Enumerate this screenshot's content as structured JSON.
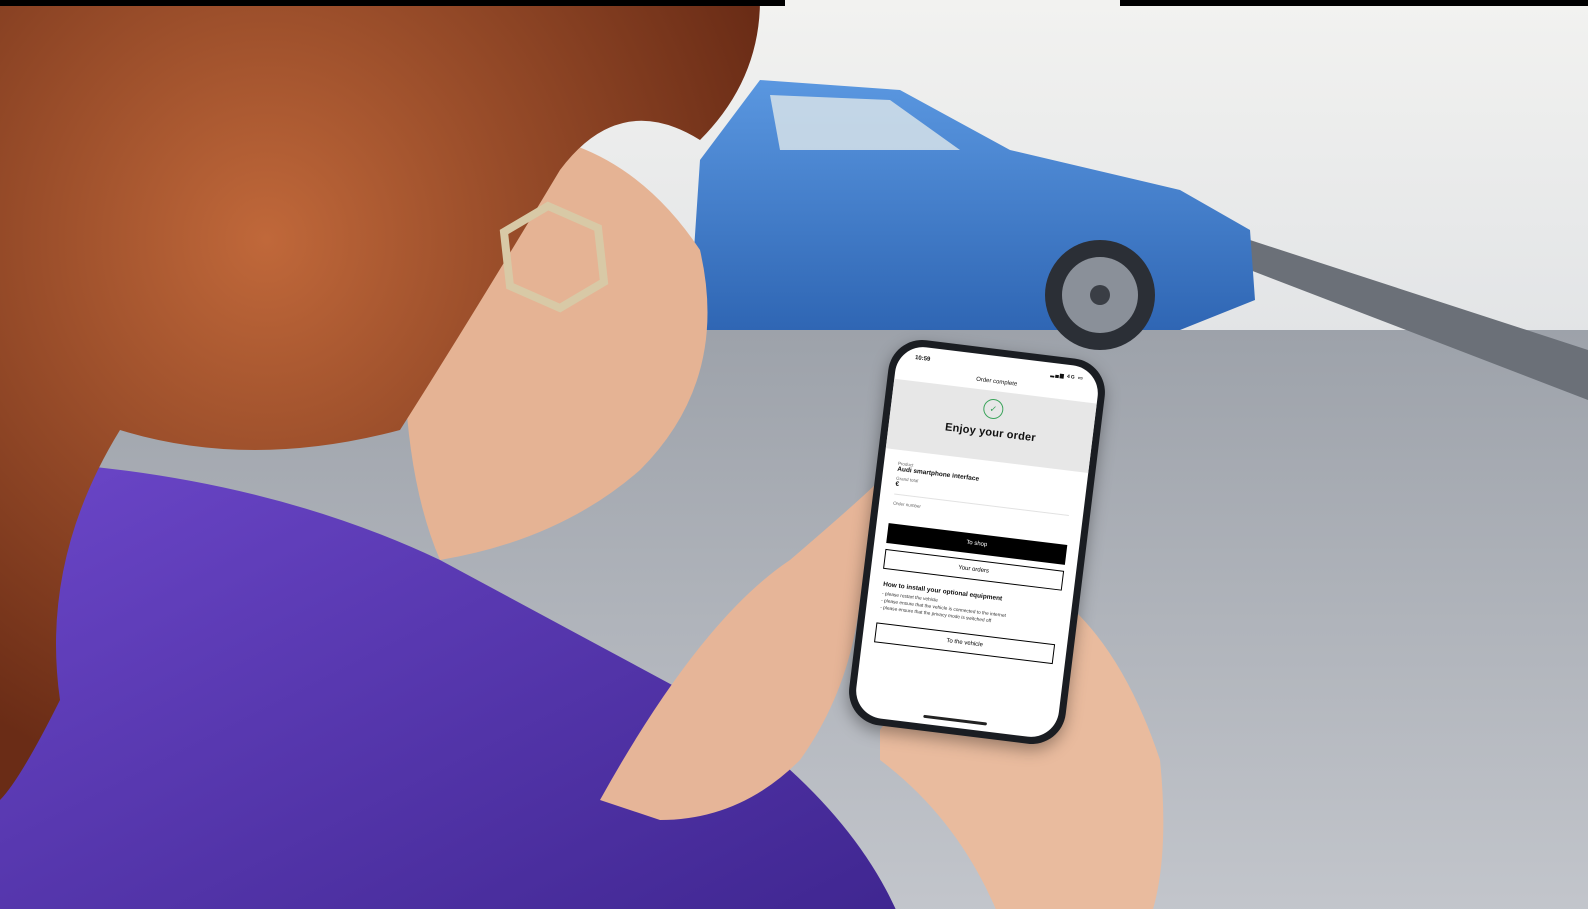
{
  "scene": {
    "description_colors": {
      "car": "#3f7fd0",
      "sweater": "#5a3ab0",
      "hair": "#a4502a",
      "pavement": "#a9adb4",
      "skin": "#e8b89a"
    }
  },
  "phone": {
    "status_time": "10:59",
    "status_icons": "4G",
    "nav_title": "Order complete",
    "hero_title": "Enjoy your order",
    "product_label": "Product",
    "product_value": "Audi smartphone interface",
    "grand_total_label": "Grand total",
    "grand_total_value": "€",
    "order_number_label": "Order number",
    "to_shop_label": "To shop",
    "your_orders_label": "Your orders",
    "install_title": "How to install your optional equipment",
    "install_steps": [
      "- please restart the vehicle",
      "- please ensure that the vehicle is connected to the internet",
      "- please ensure that the privacy mode is switched off"
    ],
    "to_vehicle_label": "To the vehicle",
    "accent_color": "#3aa35a"
  }
}
